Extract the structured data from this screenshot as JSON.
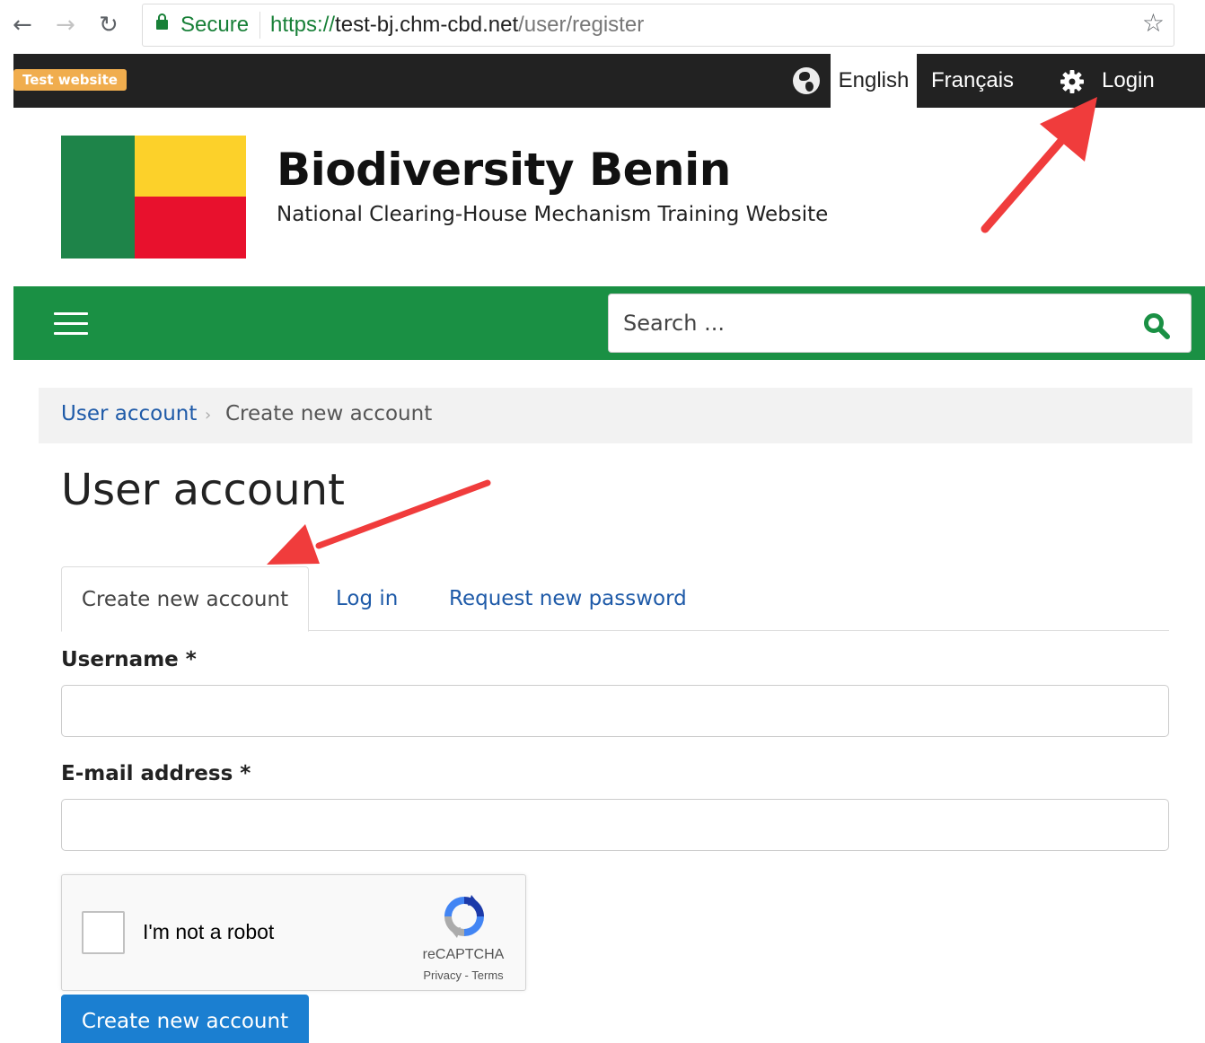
{
  "browser": {
    "secure_label": "Secure",
    "url_scheme": "https://",
    "url_host": "test-bj.chm-cbd.net",
    "url_path": "/user/register",
    "back_icon": "←",
    "forward_icon": "→",
    "reload_icon": "↻",
    "star_icon": "☆",
    "menu_icon": "⋮"
  },
  "topbar": {
    "badge": "Test website",
    "languages": [
      {
        "label": "English",
        "active": true
      },
      {
        "label": "Français",
        "active": false
      }
    ],
    "login_label": "Login"
  },
  "site": {
    "name": "Biodiversity Benin",
    "slogan": "National Clearing-House Mechanism Training Website",
    "flag_colors": {
      "green": "#1e8449",
      "yellow": "#fcd12a",
      "red": "#e8112d"
    }
  },
  "nav": {
    "search_placeholder": "Search ..."
  },
  "breadcrumb": {
    "items": [
      {
        "label": "User account",
        "link": true
      },
      {
        "label": "Create new account",
        "link": false
      }
    ],
    "separator": "›"
  },
  "page": {
    "title": "User account",
    "tabs": [
      {
        "label": "Create new account",
        "active": true
      },
      {
        "label": "Log in",
        "active": false
      },
      {
        "label": "Request new password",
        "active": false
      }
    ]
  },
  "form": {
    "username_label": "Username *",
    "username_value": "",
    "email_label": "E-mail address *",
    "email_value": "",
    "captcha": {
      "label": "I'm not a robot",
      "brand": "reCAPTCHA",
      "links": "Privacy - Terms",
      "checked": false
    },
    "submit_label": "Create new account"
  },
  "colors": {
    "green_bar": "#1a9044",
    "link": "#1e5aa8",
    "badge": "#f0ad4e",
    "button": "#1b7fd1",
    "annotation_arrow": "#f03c3c"
  }
}
